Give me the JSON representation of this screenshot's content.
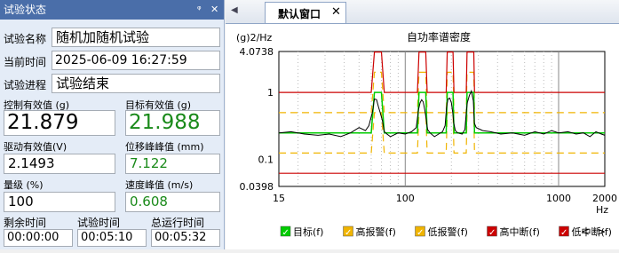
{
  "left_panel": {
    "title": "试验状态",
    "pin_glyph": "ᵠ",
    "close_glyph": "✕",
    "test_name_label": "试验名称",
    "test_name_value": "随机加随机试验",
    "time_label": "当前时间",
    "time_value": "2025-06-09 16:27:59",
    "progress_label": "试验进程",
    "progress_value": "试验结束",
    "ctrl_rms_label": "控制有效值 (g)",
    "ctrl_rms_value": "21.879",
    "target_rms_label": "目标有效值 (g)",
    "target_rms_value": "21.988",
    "drive_rms_label": "驱动有效值(V)",
    "drive_rms_value": "2.1493",
    "disp_peak_label": "位移峰峰值 (mm)",
    "disp_peak_value": "7.122",
    "level_label": "量级 (%)",
    "level_value": "100",
    "vel_peak_label": "速度峰值 (m/s)",
    "vel_peak_value": "0.608",
    "remain_label": "剩余时间",
    "remain_value": "00:00:00",
    "test_time_label": "试验时间",
    "test_time_value": "00:05:10",
    "total_time_label": "总运行时间",
    "total_time_value": "00:05:32"
  },
  "document": {
    "tab_label": "默认窗口",
    "tab_close": "✕",
    "tab_arrow": "◀"
  },
  "chart_data": {
    "type": "line",
    "title": "自功率谱密度",
    "ylabel": "(g)2/Hz",
    "xlabel": "Hz",
    "xscale": "log",
    "yscale": "log",
    "xlim": [
      15,
      2000
    ],
    "ylim": [
      0.0398,
      4.0738
    ],
    "x_ticks": [
      {
        "v": 15,
        "label": "15"
      },
      {
        "v": 100,
        "label": "100"
      },
      {
        "v": 1000,
        "label": "1000"
      },
      {
        "v": 2000,
        "label": "2000"
      }
    ],
    "y_ticks": [
      {
        "v": 4.0738,
        "label": "4.0738"
      },
      {
        "v": 1,
        "label": "1"
      },
      {
        "v": 0.1,
        "label": "0.1"
      },
      {
        "v": 0.0398,
        "label": "0.0398"
      }
    ],
    "legend": [
      {
        "name": "目标(f)",
        "color": "#00cc00"
      },
      {
        "name": "高报警(f)",
        "color": "#f0b400"
      },
      {
        "name": "低报警(f)",
        "color": "#f0b400"
      },
      {
        "name": "高中断(f)",
        "color": "#cc0000"
      },
      {
        "name": "低中断(f)",
        "color": "#cc0000"
      }
    ],
    "legend_nav": [
      "<",
      ">"
    ],
    "colors": {
      "target": "#00cc00",
      "alarm": "#f0b400",
      "abort": "#cc0000",
      "control": "#000000"
    },
    "target": {
      "x": [
        15,
        60,
        63,
        70,
        73,
        120,
        123,
        136,
        139,
        185,
        188,
        205,
        208,
        250,
        253,
        280,
        283,
        2000
      ],
      "y": [
        0.25,
        0.25,
        1.0,
        1.0,
        0.25,
        0.25,
        1.0,
        1.0,
        0.25,
        0.25,
        1.0,
        1.0,
        0.25,
        0.25,
        1.0,
        1.0,
        0.25,
        0.25
      ]
    },
    "high_alarm": {
      "x": [
        15,
        60,
        63,
        70,
        73,
        120,
        123,
        136,
        139,
        185,
        188,
        205,
        208,
        250,
        253,
        280,
        283,
        2000
      ],
      "y": [
        0.5,
        0.5,
        2.0,
        2.0,
        0.5,
        0.5,
        2.0,
        2.0,
        0.5,
        0.5,
        2.0,
        2.0,
        0.5,
        0.5,
        2.0,
        2.0,
        0.5,
        0.5
      ]
    },
    "low_alarm": {
      "x": [
        15,
        60,
        63,
        70,
        73,
        120,
        123,
        136,
        139,
        185,
        188,
        205,
        208,
        250,
        253,
        280,
        283,
        2000
      ],
      "y": [
        0.125,
        0.125,
        0.5,
        0.5,
        0.125,
        0.125,
        0.5,
        0.5,
        0.125,
        0.125,
        0.5,
        0.5,
        0.125,
        0.125,
        0.5,
        0.5,
        0.125,
        0.125
      ]
    },
    "high_abort": {
      "x": [
        15,
        60,
        63,
        70,
        73,
        120,
        123,
        136,
        139,
        185,
        188,
        205,
        208,
        250,
        253,
        280,
        283,
        2000
      ],
      "y": [
        1.0,
        1.0,
        4.0,
        4.0,
        1.0,
        1.0,
        4.0,
        4.0,
        1.0,
        1.0,
        4.0,
        4.0,
        1.0,
        1.0,
        4.0,
        4.0,
        1.0,
        1.0
      ]
    },
    "low_abort": {
      "x": [
        15,
        2000
      ],
      "y": [
        0.0625,
        0.0625
      ]
    },
    "control": {
      "x": [
        15,
        18,
        22,
        27,
        32,
        38,
        44,
        50,
        55,
        58,
        61,
        63,
        65,
        67,
        69,
        71,
        73,
        76,
        80,
        90,
        100,
        110,
        118,
        122,
        125,
        128,
        131,
        134,
        137,
        140,
        145,
        155,
        165,
        175,
        182,
        186,
        190,
        195,
        200,
        204,
        207,
        212,
        220,
        235,
        245,
        250,
        254,
        262,
        270,
        278,
        282,
        290,
        320,
        360,
        420,
        500,
        600,
        700,
        800,
        900,
        1000,
        1150,
        1300,
        1450,
        1600,
        1750,
        1900,
        2000
      ],
      "y": [
        0.25,
        0.26,
        0.24,
        0.23,
        0.24,
        0.22,
        0.25,
        0.3,
        0.27,
        0.32,
        0.5,
        0.8,
        0.78,
        0.6,
        0.48,
        0.38,
        0.26,
        0.24,
        0.22,
        0.25,
        0.24,
        0.26,
        0.3,
        0.55,
        0.7,
        0.78,
        0.72,
        0.55,
        0.4,
        0.28,
        0.25,
        0.22,
        0.24,
        0.26,
        0.32,
        0.6,
        0.8,
        0.82,
        0.7,
        0.5,
        0.35,
        0.27,
        0.25,
        0.24,
        0.28,
        0.5,
        0.7,
        0.9,
        1.05,
        0.75,
        0.35,
        0.3,
        0.27,
        0.26,
        0.24,
        0.25,
        0.23,
        0.26,
        0.24,
        0.27,
        0.25,
        0.26,
        0.24,
        0.25,
        0.22,
        0.26,
        0.24,
        0.23
      ]
    }
  }
}
